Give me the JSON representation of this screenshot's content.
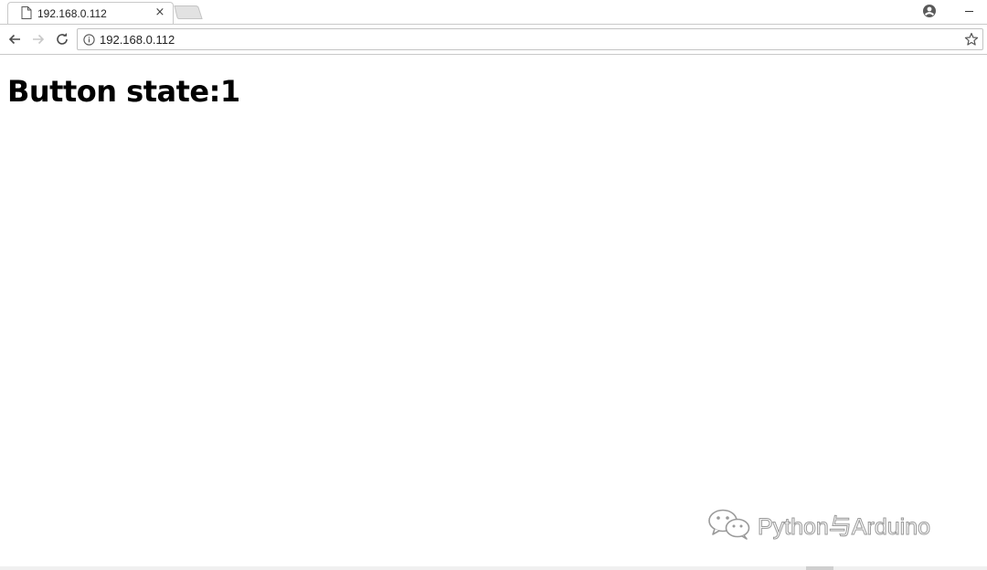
{
  "tab": {
    "title": "192.168.0.112",
    "close_glyph": "×",
    "icon": "page-icon"
  },
  "toolbar": {
    "back_icon": "back-arrow-icon",
    "forward_icon": "forward-arrow-icon",
    "reload_icon": "reload-icon",
    "address": {
      "url": "192.168.0.112",
      "info_icon": "info-icon",
      "bookmark_icon": "star-icon"
    }
  },
  "window": {
    "profile_icon": "profile-icon",
    "minimize_icon": "minimize-icon"
  },
  "page": {
    "heading": "Button state:1"
  },
  "watermark": {
    "text": "Python与Arduino",
    "icon": "wechat-icon"
  },
  "colors": {
    "tab_border": "#c9c9c9",
    "heading": "#000000",
    "watermark_stroke": "#9a9a9a"
  }
}
